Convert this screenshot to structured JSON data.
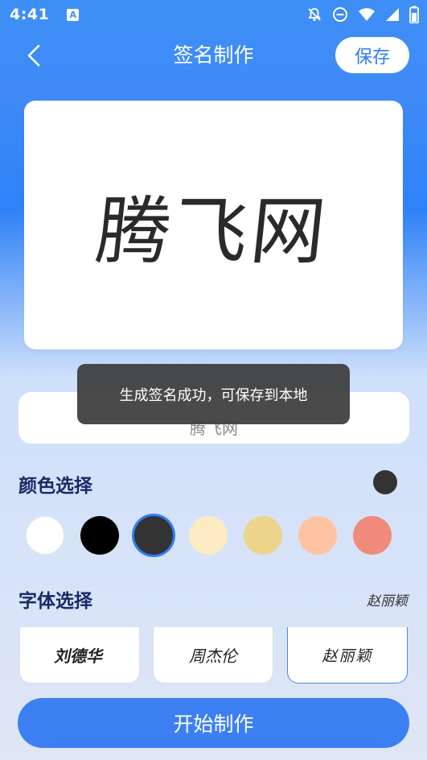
{
  "status_bar": {
    "time": "4:41",
    "app_icon_letter": "A"
  },
  "nav": {
    "title": "签名制作",
    "save_label": "保存"
  },
  "preview": {
    "signature_text": "腾飞网"
  },
  "input": {
    "value": "腾飞网"
  },
  "toast": {
    "message": "生成签名成功，可保存到本地"
  },
  "color_section": {
    "title": "颜色选择",
    "current_color": "#333333",
    "swatches": [
      "#ffffff",
      "#000000",
      "#333333",
      "#fcebc3",
      "#edd48c",
      "#fec4a2",
      "#f08a7a"
    ],
    "selected_index": 2
  },
  "font_section": {
    "title": "字体选择",
    "current_font": "赵丽颖",
    "fonts": [
      "刘德华",
      "周杰伦",
      "赵丽颖"
    ],
    "selected_index": 2
  },
  "actions": {
    "start_label": "开始制作"
  }
}
